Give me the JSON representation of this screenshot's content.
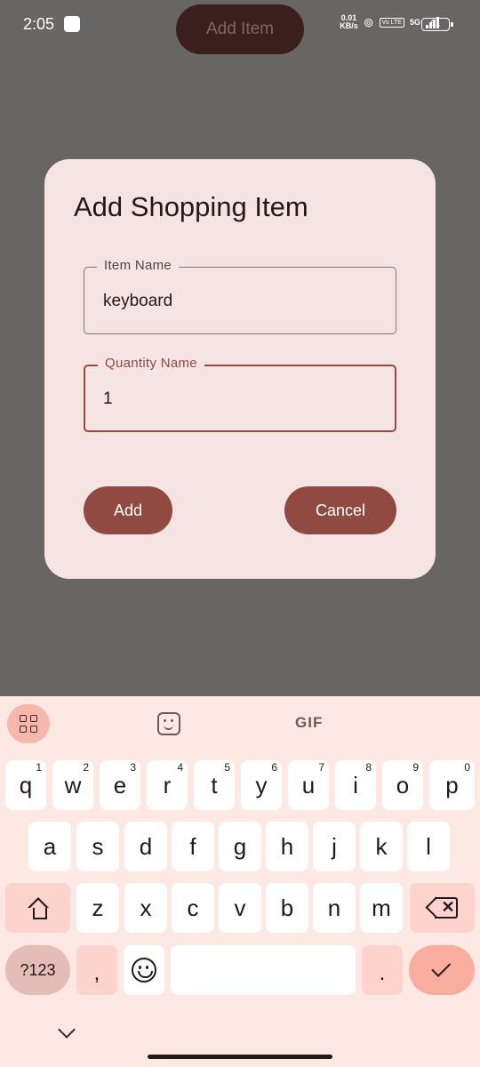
{
  "status_bar": {
    "time": "2:05",
    "speed_value": "0.01",
    "speed_unit": "KB/s",
    "volte": "Vo LTE",
    "network": "5G",
    "battery": "61"
  },
  "background": {
    "add_item_button": "Add Item"
  },
  "dialog": {
    "title": "Add Shopping Item",
    "item_name_label": "Item Name",
    "item_name_value": "keyboard",
    "quantity_label": "Quantity Name",
    "quantity_value": "1",
    "add_button": "Add",
    "cancel_button": "Cancel"
  },
  "keyboard": {
    "toolbar": {
      "gif_label": "GIF"
    },
    "row1": [
      {
        "key": "q",
        "hint": "1"
      },
      {
        "key": "w",
        "hint": "2"
      },
      {
        "key": "e",
        "hint": "3"
      },
      {
        "key": "r",
        "hint": "4"
      },
      {
        "key": "t",
        "hint": "5"
      },
      {
        "key": "y",
        "hint": "6"
      },
      {
        "key": "u",
        "hint": "7"
      },
      {
        "key": "i",
        "hint": "8"
      },
      {
        "key": "o",
        "hint": "9"
      },
      {
        "key": "p",
        "hint": "0"
      }
    ],
    "row2": [
      "a",
      "s",
      "d",
      "f",
      "g",
      "h",
      "j",
      "k",
      "l"
    ],
    "row3": [
      "z",
      "x",
      "c",
      "v",
      "b",
      "n",
      "m"
    ],
    "symbols_key": "?123",
    "comma_key": ",",
    "period_key": ".",
    "icons": {
      "apps": "apps-grid-icon",
      "sticker": "sticker-icon",
      "shift": "shift-icon",
      "backspace": "backspace-icon",
      "emoji": "emoji-icon",
      "enter": "checkmark-icon",
      "hide": "chevron-down-icon"
    }
  },
  "colors": {
    "scrim": "#686664",
    "dialog_bg": "#f5e4e2",
    "primary": "#904a42",
    "keyboard_bg": "#fde8e4"
  }
}
